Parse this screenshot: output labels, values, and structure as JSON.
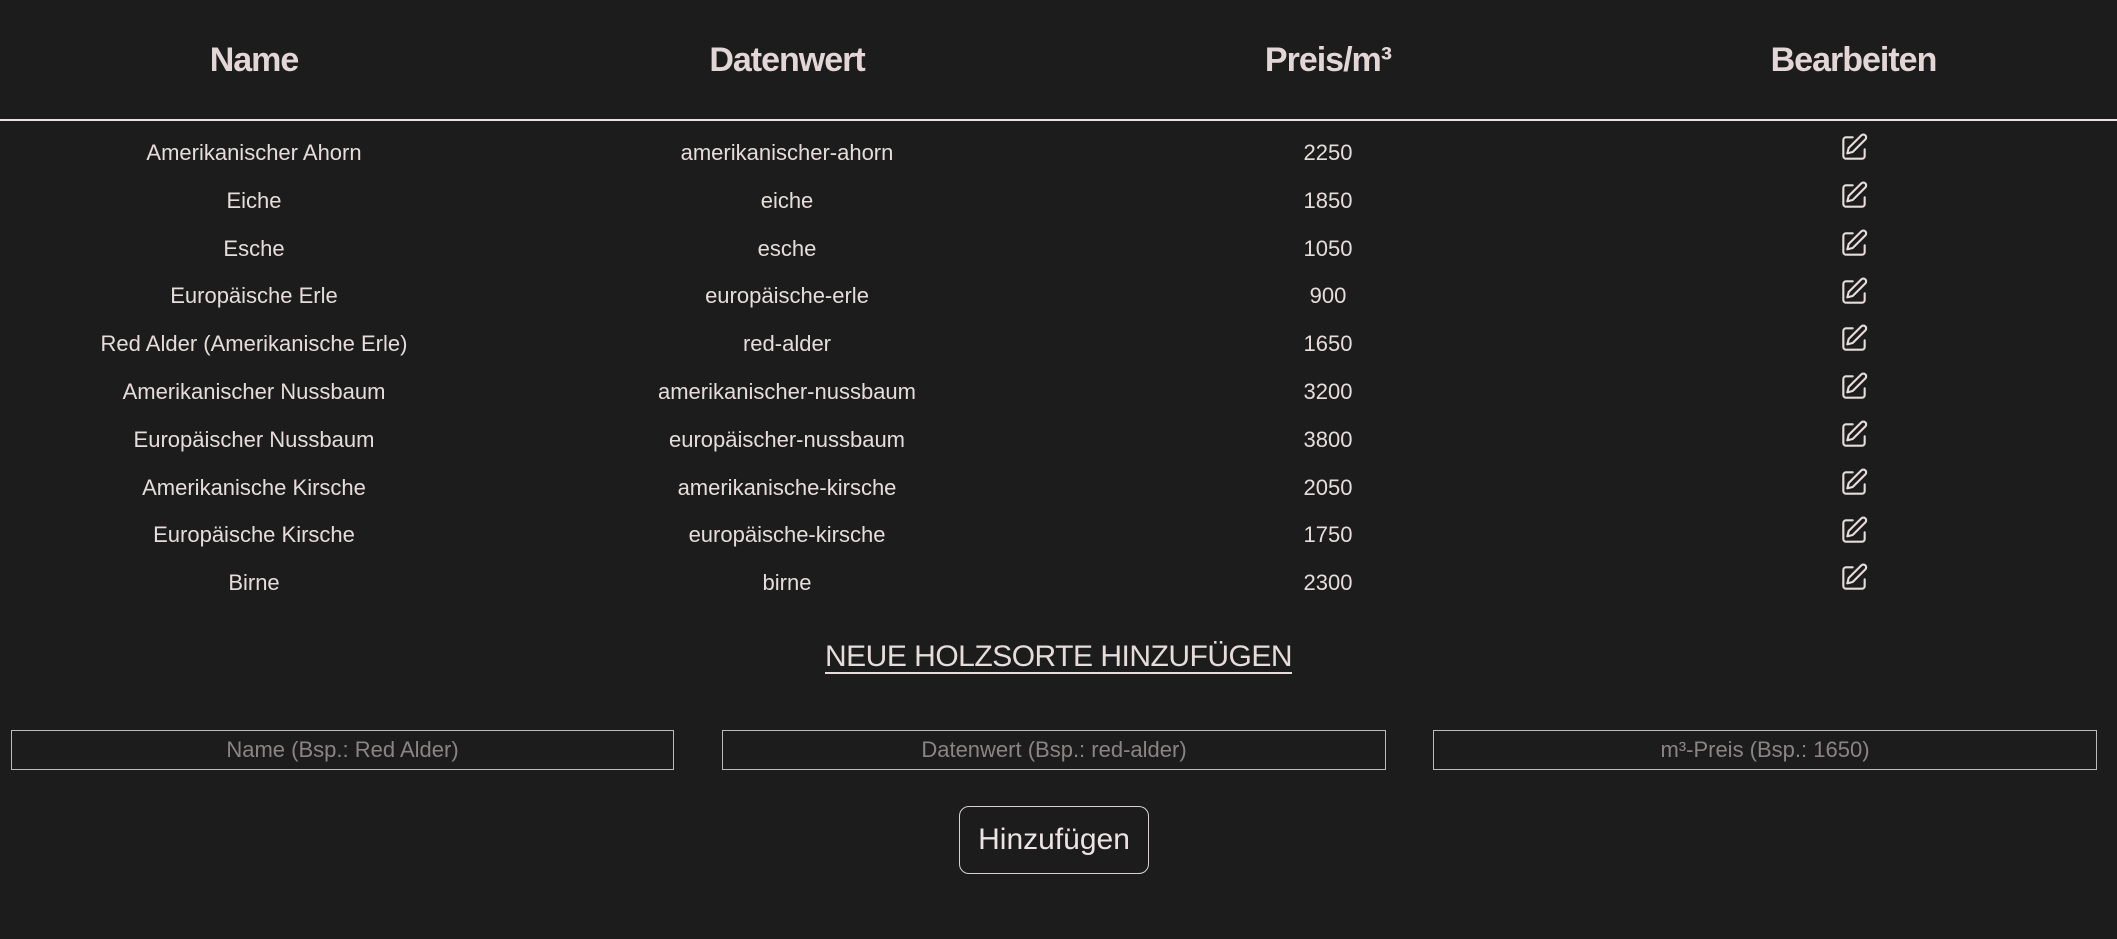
{
  "table": {
    "headers": [
      "Name",
      "Datenwert",
      "Preis/m³",
      "Bearbeiten"
    ],
    "rows": [
      {
        "name": "Amerikanischer Ahorn",
        "value": "amerikanischer-ahorn",
        "price": "2250"
      },
      {
        "name": "Eiche",
        "value": "eiche",
        "price": "1850"
      },
      {
        "name": "Esche",
        "value": "esche",
        "price": "1050"
      },
      {
        "name": "Europäische Erle",
        "value": "europäische-erle",
        "price": "900"
      },
      {
        "name": "Red Alder (Amerikanische Erle)",
        "value": "red-alder",
        "price": "1650"
      },
      {
        "name": "Amerikanischer Nussbaum",
        "value": "amerikanischer-nussbaum",
        "price": "3200"
      },
      {
        "name": "Europäischer Nussbaum",
        "value": "europäischer-nussbaum",
        "price": "3800"
      },
      {
        "name": "Amerikanische Kirsche",
        "value": "amerikanische-kirsche",
        "price": "2050"
      },
      {
        "name": "Europäische Kirsche",
        "value": "europäische-kirsche",
        "price": "1750"
      },
      {
        "name": "Birne",
        "value": "birne",
        "price": "2300"
      }
    ],
    "edit_icon": "edit-icon"
  },
  "add_form": {
    "heading": "NEUE HOLZSORTE HINZUFÜGEN",
    "name_placeholder": "Name (Bsp.: Red Alder)",
    "value_placeholder": "Datenwert (Bsp.: red-alder)",
    "price_placeholder": "m³-Preis (Bsp.: 1650)",
    "name_value": "",
    "value_value": "",
    "price_value": "",
    "submit_label": "Hinzufügen"
  },
  "colors": {
    "background": "#1c1c1c",
    "text": "#e6dcdc",
    "placeholder": "#8a8585"
  }
}
